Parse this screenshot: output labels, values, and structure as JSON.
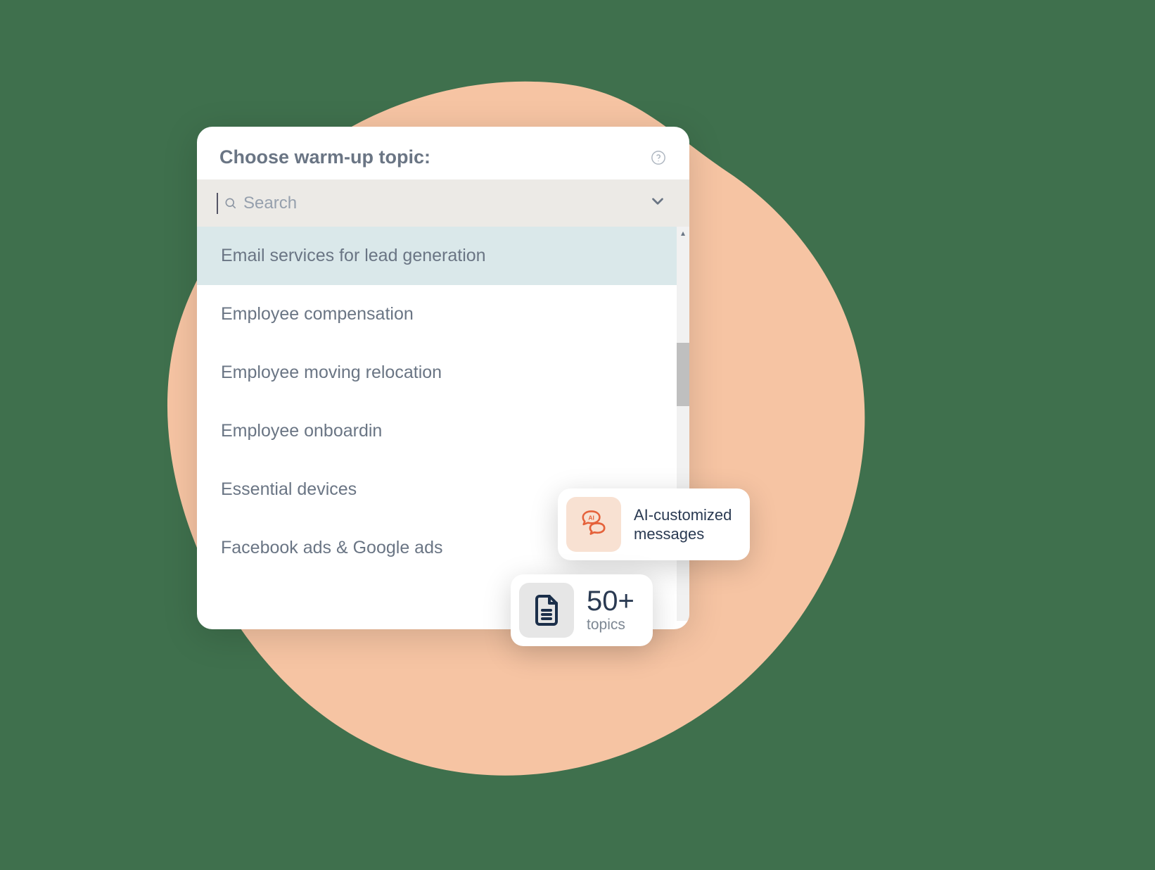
{
  "header": {
    "title": "Choose warm-up topic:"
  },
  "search": {
    "placeholder": "Search"
  },
  "list": {
    "items": [
      {
        "label": "Email services for lead generation",
        "selected": true
      },
      {
        "label": "Employee compensation",
        "selected": false
      },
      {
        "label": "Employee moving relocation",
        "selected": false
      },
      {
        "label": "Employee onboardin",
        "selected": false
      },
      {
        "label": "Essential devices",
        "selected": false
      },
      {
        "label": "Facebook ads & Google ads",
        "selected": false
      }
    ]
  },
  "badges": {
    "ai": {
      "line1": "AI-customized",
      "line2": "messages"
    },
    "topics": {
      "count": "50+",
      "label": "topics"
    }
  },
  "colors": {
    "bg_green": "#3f704d",
    "blob": "#f6c4a3",
    "selected_row": "#dae8ea",
    "text_muted": "#6a7584",
    "accent_orange": "#e5623b"
  }
}
